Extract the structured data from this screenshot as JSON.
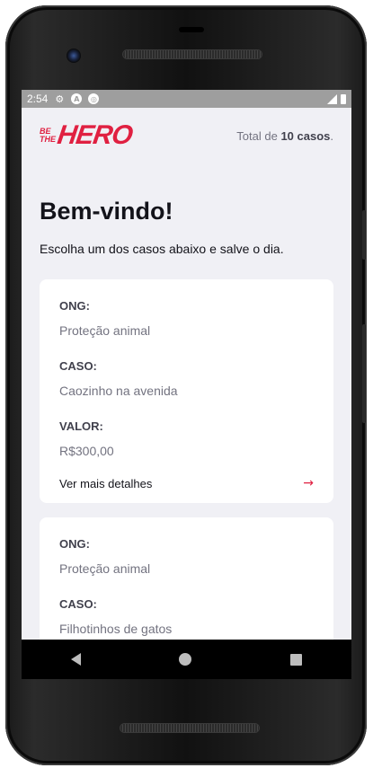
{
  "status_bar": {
    "time": "2:54",
    "icons": [
      "settings-icon",
      "a-circle-icon",
      "sync-circle-icon",
      "signal-icon",
      "battery-icon"
    ]
  },
  "header": {
    "logo_small": "BE THE",
    "logo_big": "HERO",
    "total_prefix": "Total de",
    "total_count": "10 casos",
    "total_suffix": "."
  },
  "main": {
    "title": "Bem-vindo!",
    "description": "Escolha um dos casos abaixo e salve o dia."
  },
  "incidents": [
    {
      "ong_label": "ONG:",
      "ong": "Proteção animal",
      "caso_label": "CASO:",
      "caso": "Caozinho na avenida",
      "valor_label": "VALOR:",
      "valor": "R$300,00",
      "details_label": "Ver mais detalhes"
    },
    {
      "ong_label": "ONG:",
      "ong": "Proteção animal",
      "caso_label": "CASO:",
      "caso": "Filhotinhos de gatos"
    }
  ],
  "colors": {
    "brand": "#e02041",
    "background": "#f0f0f5",
    "card": "#ffffff",
    "text_dark": "#13131a",
    "text_muted": "#737380"
  },
  "nav_bar": {
    "icons": [
      "back-icon",
      "home-icon",
      "recents-icon"
    ]
  }
}
